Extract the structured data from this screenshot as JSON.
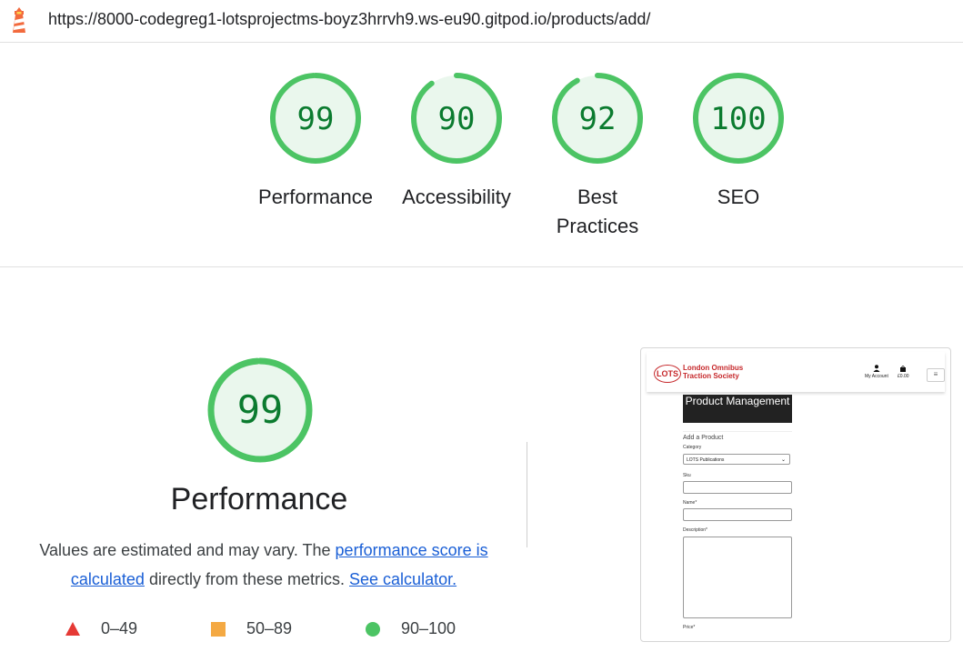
{
  "address_bar": {
    "url": "https://8000-codegreg1-lotsprojectms-boyz3hrrvh9.ws-eu90.gitpod.io/products/add/"
  },
  "summary_gauges": [
    {
      "score": "99",
      "value": 99,
      "label": "Performance"
    },
    {
      "score": "90",
      "value": 90,
      "label": "Accessibility"
    },
    {
      "score": "92",
      "value": 92,
      "label": "Best Practices"
    },
    {
      "score": "100",
      "value": 100,
      "label": "SEO"
    }
  ],
  "performance": {
    "score": "99",
    "value": 99,
    "title": "Performance",
    "desc_text_1": "Values are estimated and may vary. The ",
    "link_score": "performance score is calculated",
    "desc_text_2": " directly from these metrics. ",
    "link_calculator": "See calculator."
  },
  "legend": [
    {
      "range": "0–49",
      "icon": "red-triangle-icon",
      "color": "#e53935"
    },
    {
      "range": "50–89",
      "icon": "orange-square-icon",
      "color": "#f4a943"
    },
    {
      "range": "90–100",
      "icon": "green-circle-icon",
      "color": "#4cc464"
    }
  ],
  "colors": {
    "pass_stroke": "#4cc464",
    "pass_fill": "#eaf7ed",
    "pass_text": "#0b7b2f",
    "link": "#1a5fd6"
  },
  "preview": {
    "logo_text": "LOTS",
    "brand_line1": "London Omnibus",
    "brand_line2": "Traction Society",
    "my_account": "My Account",
    "bag_total": "£0.00",
    "page_title": "Product Management",
    "subtitle": "Add a Product",
    "category_label": "Category",
    "category_value": "LOTS Publications",
    "sku_label": "Sku",
    "name_label": "Name*",
    "description_label": "Description*",
    "price_label": "Price*"
  }
}
